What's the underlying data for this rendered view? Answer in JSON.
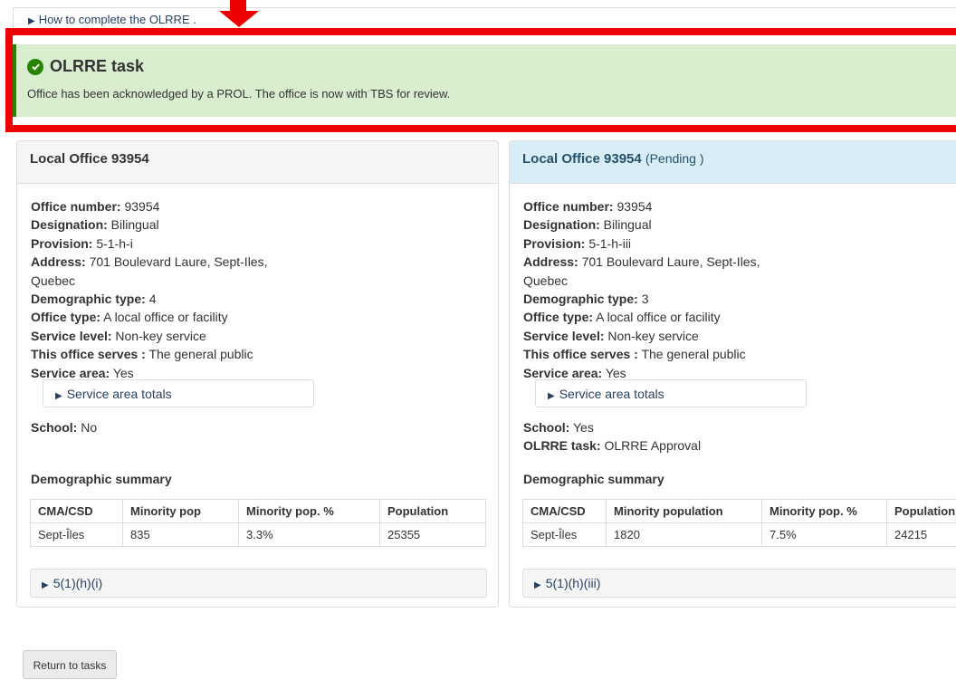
{
  "howto": {
    "label": "How to complete the OLRRE ."
  },
  "alert": {
    "title": "OLRRE task",
    "message": "Office has been acknowledged by a PROL. The office is now with TBS for review.",
    "color": "#278400"
  },
  "left_panel": {
    "title": "Local Office 93954",
    "fields": [
      {
        "label": "Office number:",
        "value": " 93954"
      },
      {
        "label": "Designation:",
        "value": " Bilingual"
      },
      {
        "label": "Provision:",
        "value": " 5-1-h-i"
      },
      {
        "label": "Address:",
        "value": " 701 Boulevard Laure, Sept-Iles,"
      },
      {
        "label": "",
        "value": "Quebec"
      },
      {
        "label": "Demographic type:",
        "value": " 4"
      },
      {
        "label": "Office type:",
        "value": " A local office or facility"
      },
      {
        "label": "Service level:",
        "value": " Non-key service"
      },
      {
        "label": "This office serves :",
        "value": " The general public"
      },
      {
        "label": "Service area:",
        "value": " Yes"
      }
    ],
    "service_area_totals": "Service area totals",
    "school": {
      "label": "School:",
      "value": " No"
    },
    "demo_title": "Demographic summary",
    "table": {
      "headers": [
        "CMA/CSD",
        "Minority pop",
        "Minority pop. %",
        "Population"
      ],
      "rows": [
        [
          "Sept-Îles",
          "835",
          "3.3%",
          "25355"
        ]
      ]
    },
    "section": "5(1)(h)(i)"
  },
  "right_panel": {
    "title": "Local Office 93954",
    "status": "(Pending )",
    "fields": [
      {
        "label": "Office number:",
        "value": " 93954"
      },
      {
        "label": "Designation:",
        "value": " Bilingual"
      },
      {
        "label": "Provision:",
        "value": " 5-1-h-iii"
      },
      {
        "label": "Address:",
        "value": " 701 Boulevard Laure, Sept-Iles,"
      },
      {
        "label": "",
        "value": "Quebec"
      },
      {
        "label": "Demographic type:",
        "value": " 3"
      },
      {
        "label": "Office type:",
        "value": " A local office or facility"
      },
      {
        "label": "Service level:",
        "value": " Non-key service"
      },
      {
        "label": "This office serves :",
        "value": " The general public"
      },
      {
        "label": "Service area:",
        "value": " Yes"
      }
    ],
    "service_area_totals": "Service area totals",
    "school": {
      "label": "School:",
      "value": " Yes"
    },
    "olrre_task": {
      "label": "OLRRE task:",
      "value": " OLRRE Approval"
    },
    "demo_title": "Demographic summary",
    "table": {
      "headers": [
        "CMA/CSD",
        "Minority population",
        "Minority pop. %",
        "Population"
      ],
      "rows": [
        [
          "Sept-Îles",
          "1820",
          "7.5%",
          "24215"
        ]
      ]
    },
    "section": "5(1)(h)(iii)"
  },
  "return_button": "Return to tasks"
}
